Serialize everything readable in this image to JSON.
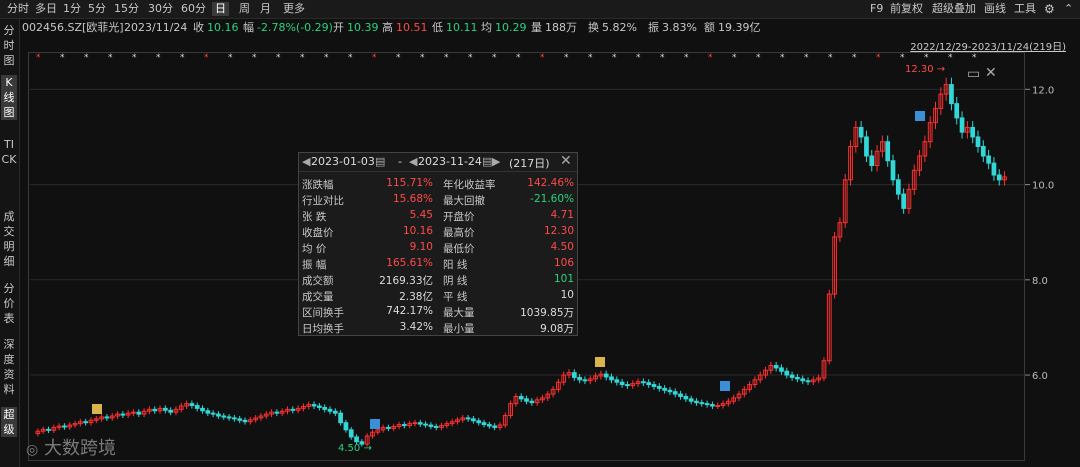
{
  "toolbar": {
    "tabs": [
      "分时",
      "多日",
      "1分",
      "5分",
      "15分",
      "30分",
      "60分",
      "日",
      "周",
      "月",
      "更多"
    ],
    "active": "日",
    "right": [
      "F9",
      "前复权",
      "超级叠加",
      "画线",
      "工具"
    ]
  },
  "info": {
    "code": "002456.SZ[欧菲光]",
    "date": "2023/11/24",
    "close_label": "收",
    "close": "10.16",
    "change_label": "幅",
    "change": "-2.78%(-0.29)",
    "open_label": "开",
    "open": "10.39",
    "high_label": "高",
    "high": "10.51",
    "low_label": "低",
    "low": "10.11",
    "avg_label": "均",
    "avg": "10.29",
    "vol_label": "量",
    "vol": "188万",
    "turnover_label": "换",
    "turnover": "5.82%",
    "amp_label": "振",
    "amp": "3.83%",
    "amount_label": "额",
    "amount": "19.39亿"
  },
  "sidebar": [
    "分时图",
    "K线图",
    "TICK",
    "成交明细",
    "分价表",
    "深度资料",
    "超级"
  ],
  "range_label": "2022/12/29-2023/11/24(219日)",
  "popup": {
    "start": "2023-01-03",
    "sep": "-",
    "end": "2023-11-24",
    "days": "(217日)",
    "rows": [
      {
        "l1": "涨跌幅",
        "v1": "115.71%",
        "c1": "red",
        "l2": "年化收益率",
        "v2": "142.46%",
        "c2": "red"
      },
      {
        "l1": "行业对比",
        "v1": "15.68%",
        "c1": "red",
        "l2": "最大回撤",
        "v2": "-21.60%",
        "c2": "green"
      },
      {
        "l1": "张    跌",
        "v1": "5.45",
        "c1": "red",
        "l2": "开盘价",
        "v2": "4.71",
        "c2": "red"
      },
      {
        "l1": "收盘价",
        "v1": "10.16",
        "c1": "red",
        "l2": "最高价",
        "v2": "12.30",
        "c2": "red"
      },
      {
        "l1": "均    价",
        "v1": "9.10",
        "c1": "red",
        "l2": "最低价",
        "v2": "4.50",
        "c2": "red"
      },
      {
        "l1": "振    幅",
        "v1": "165.61%",
        "c1": "red",
        "l2": "阳    线",
        "v2": "106",
        "c2": "red"
      },
      {
        "l1": "成交额",
        "v1": "2169.33亿",
        "c1": "wht",
        "l2": "阴    线",
        "v2": "101",
        "c2": "green"
      },
      {
        "l1": "成交量",
        "v1": "2.38亿",
        "c1": "wht",
        "l2": "平    线",
        "v2": "10",
        "c2": "wht"
      },
      {
        "l1": "区间换手",
        "v1": "742.17%",
        "c1": "wht",
        "l2": "最大量",
        "v2": "1039.85万",
        "c2": "wht"
      },
      {
        "l1": "日均换手",
        "v1": "3.42%",
        "c1": "wht",
        "l2": "最小量",
        "v2": "9.08万",
        "c2": "wht"
      }
    ]
  },
  "chart_data": {
    "type": "candlestick",
    "y_ticks": [
      "12.0",
      "10.0",
      "8.0",
      "6.0"
    ],
    "y_tick_values": [
      12.0,
      10.0,
      8.0,
      6.0
    ],
    "ylim": [
      4.3,
      12.7
    ],
    "high_annotation": "12.30",
    "low_annotation": "4.50",
    "closes": [
      4.82,
      4.86,
      4.84,
      4.9,
      4.93,
      4.91,
      4.95,
      4.98,
      5.02,
      5.0,
      5.05,
      5.08,
      5.12,
      5.1,
      5.14,
      5.18,
      5.16,
      5.2,
      5.22,
      5.18,
      5.24,
      5.28,
      5.25,
      5.3,
      5.26,
      5.22,
      5.28,
      5.35,
      5.4,
      5.36,
      5.3,
      5.25,
      5.2,
      5.18,
      5.14,
      5.12,
      5.1,
      5.08,
      5.05,
      5.02,
      5.06,
      5.1,
      5.14,
      5.18,
      5.22,
      5.2,
      5.24,
      5.28,
      5.26,
      5.3,
      5.34,
      5.38,
      5.35,
      5.32,
      5.28,
      5.24,
      5.2,
      5.0,
      4.85,
      4.7,
      4.6,
      4.55,
      4.72,
      4.8,
      4.85,
      4.9,
      4.88,
      4.92,
      4.96,
      4.94,
      4.98,
      5.0,
      4.97,
      4.95,
      4.92,
      4.9,
      4.94,
      4.98,
      5.02,
      5.06,
      5.1,
      5.08,
      5.04,
      5.0,
      4.96,
      4.93,
      4.9,
      4.95,
      5.15,
      5.4,
      5.55,
      5.5,
      5.45,
      5.42,
      5.48,
      5.52,
      5.6,
      5.7,
      5.85,
      6.0,
      6.05,
      5.95,
      5.9,
      5.88,
      5.92,
      5.98,
      6.02,
      5.96,
      5.9,
      5.85,
      5.8,
      5.78,
      5.82,
      5.86,
      5.84,
      5.8,
      5.76,
      5.72,
      5.68,
      5.65,
      5.6,
      5.55,
      5.5,
      5.45,
      5.42,
      5.4,
      5.38,
      5.35,
      5.36,
      5.4,
      5.45,
      5.52,
      5.6,
      5.7,
      5.8,
      5.9,
      6.0,
      6.1,
      6.2,
      6.15,
      6.08,
      6.0,
      5.95,
      5.92,
      5.88,
      5.86,
      5.9,
      5.94,
      6.3,
      7.7,
      8.9,
      9.2,
      10.1,
      10.8,
      11.2,
      11.0,
      10.6,
      10.4,
      10.7,
      10.9,
      10.5,
      10.1,
      9.8,
      9.5,
      9.9,
      10.3,
      10.6,
      10.9,
      11.3,
      11.6,
      11.9,
      12.1,
      11.7,
      11.4,
      11.1,
      11.2,
      11.0,
      10.8,
      10.6,
      10.45,
      10.2,
      10.1,
      10.16
    ]
  },
  "watermark": "大数跨境",
  "colors": {
    "up": "#ff3030",
    "down": "#32d7d7",
    "grid": "#2a2a2a"
  }
}
